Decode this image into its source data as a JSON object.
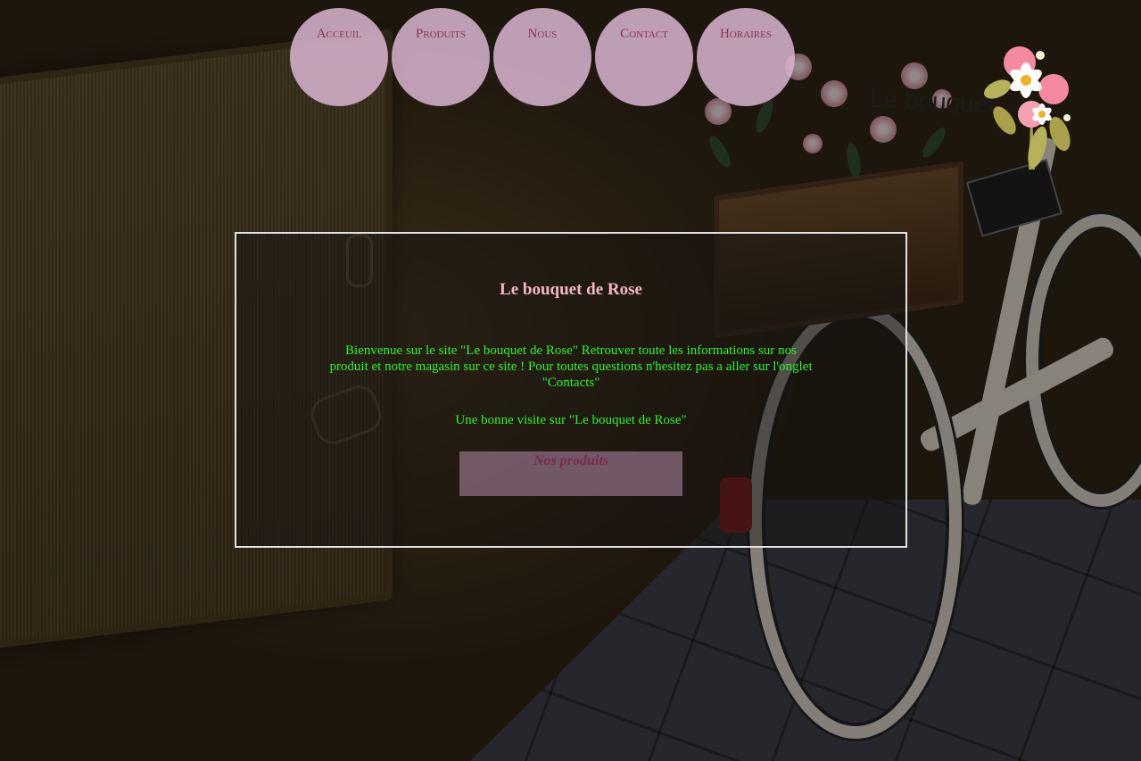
{
  "nav": {
    "items": [
      {
        "label": "Acceuil"
      },
      {
        "label": "Produits"
      },
      {
        "label": "Nous"
      },
      {
        "label": "Contact"
      },
      {
        "label": "Horaires"
      }
    ]
  },
  "main": {
    "title": "Le bouquet de Rose",
    "welcome": "Bienvenue sur le site \"Le bouquet de Rose\" Retrouver toute les informations sur nos produit et notre magasin sur ce site ! Pour toutes questions n'hesitez pas a aller sur l'onglet \"Contacts\"",
    "good_visit": "Une bonne visite sur \"Le bouquet de Rose\"",
    "products_button": "Nos produits"
  },
  "background": {
    "sign_text": "Le bouquet"
  },
  "colors": {
    "nav_bg": "#dab6d4",
    "nav_text": "#8a3355",
    "title": "#f4b6c6",
    "body_text": "#2df52d",
    "button_bg": "#aa82a0"
  },
  "icons": {
    "logo": "flower-bouquet-logo-icon"
  }
}
